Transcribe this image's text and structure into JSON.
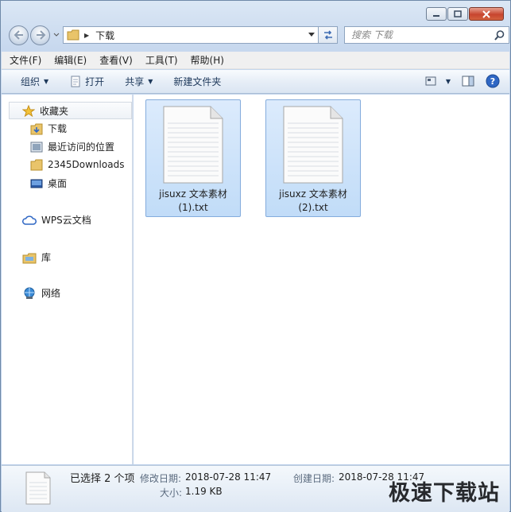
{
  "window": {
    "controls": [
      "minimize-icon",
      "maximize-icon",
      "close-icon"
    ]
  },
  "address": {
    "path": "下载",
    "search_placeholder": "搜索 下载"
  },
  "menu": [
    "文件(F)",
    "编辑(E)",
    "查看(V)",
    "工具(T)",
    "帮助(H)"
  ],
  "toolbar": {
    "organize": "组织",
    "open": "打开",
    "share": "共享",
    "new_folder": "新建文件夹"
  },
  "nav": {
    "favorites": "收藏夹",
    "items": [
      "下载",
      "最近访问的位置",
      "2345Downloads",
      "桌面"
    ],
    "wps": "WPS云文档",
    "library": "库",
    "network": "网络"
  },
  "files": [
    {
      "line1": "jisuxz 文本素材",
      "line2": "(1).txt"
    },
    {
      "line1": "jisuxz 文本素材",
      "line2": "(2).txt"
    }
  ],
  "details": {
    "selected": "已选择 2 个项",
    "modified_label": "修改日期:",
    "modified": "2018-07-28 11:47",
    "created_label": "创建日期:",
    "created": "2018-07-28 11:47",
    "size_label": "大小:",
    "size": "1.19 KB"
  },
  "watermark": "极速下载站"
}
